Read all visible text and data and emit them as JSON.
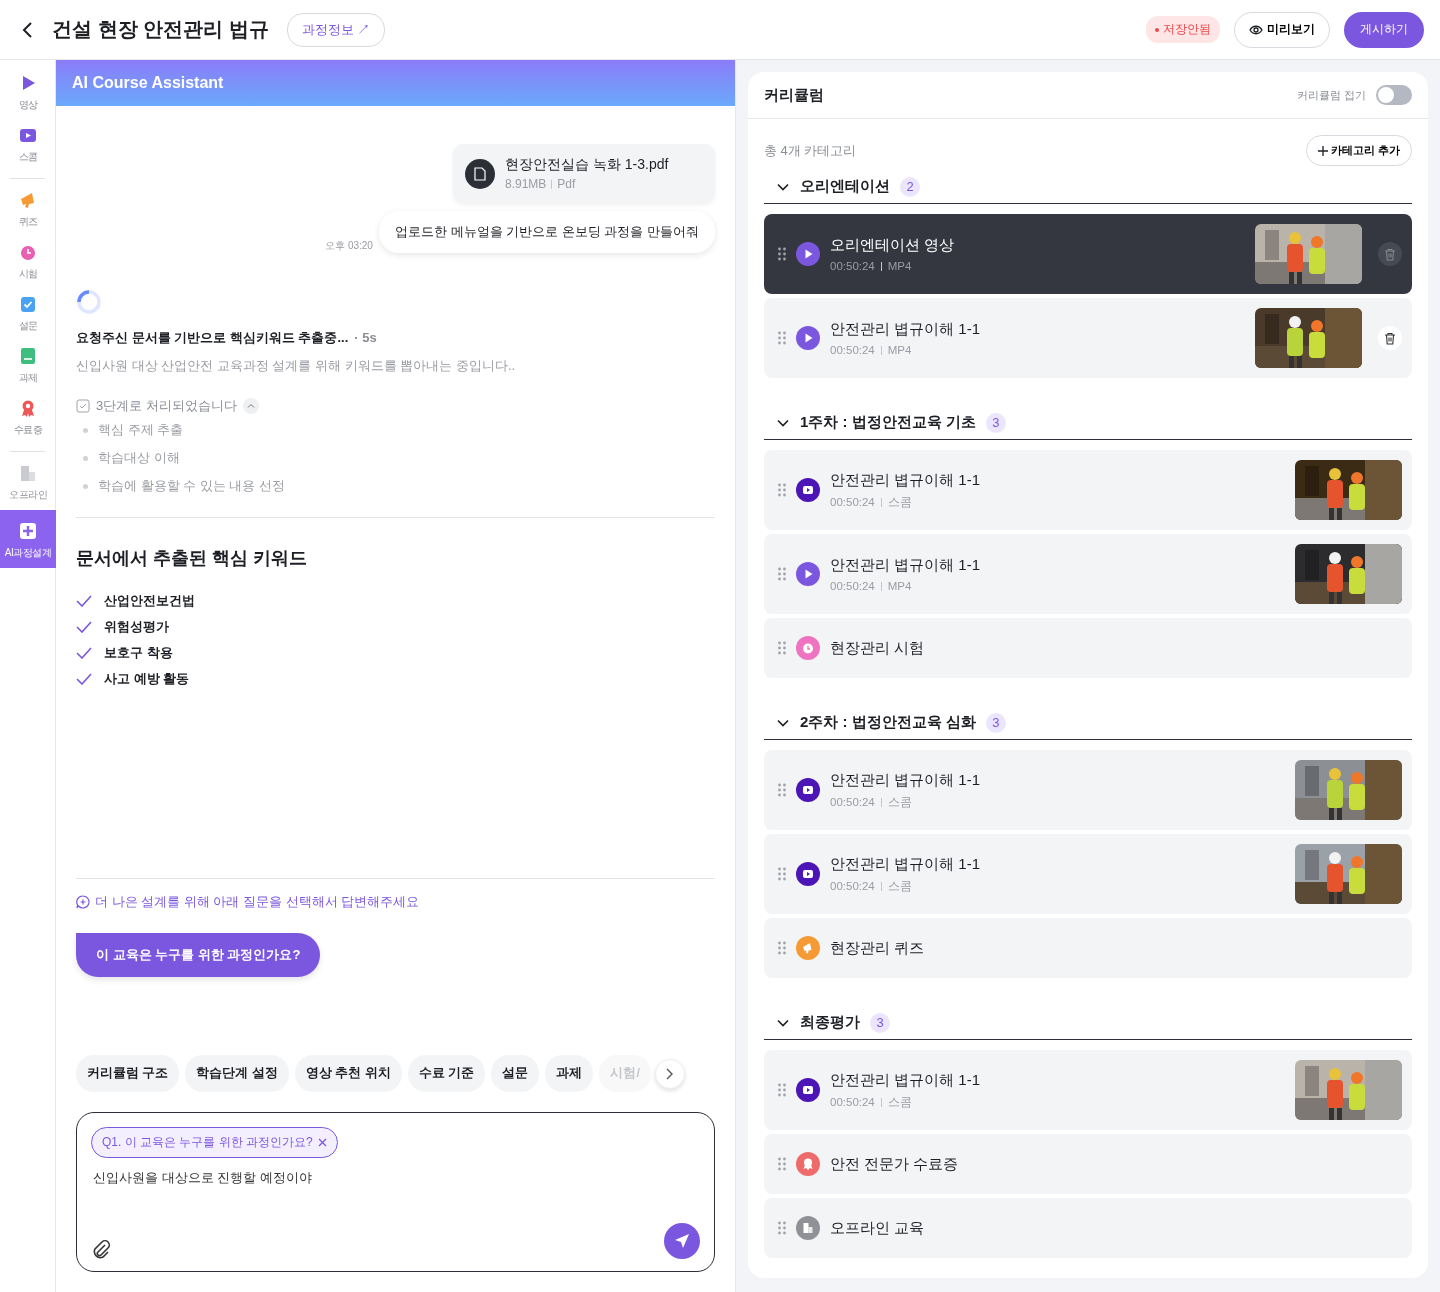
{
  "header": {
    "title": "건설 현장 안전관리 법규",
    "info_link": "과정정보 ↗",
    "status": "저장안됨",
    "preview": "미리보기",
    "publish": "게시하기"
  },
  "sidebar": {
    "groups": [
      [
        {
          "kind": "video",
          "label": "영상",
          "selected": false
        },
        {
          "kind": "scorm",
          "label": "스콤",
          "selected": false
        }
      ],
      [
        {
          "kind": "quiz",
          "label": "퀴즈",
          "selected": false
        },
        {
          "kind": "exam",
          "label": "시험",
          "selected": false
        },
        {
          "kind": "survey",
          "label": "설문",
          "selected": false
        },
        {
          "kind": "task",
          "label": "과제",
          "selected": false
        },
        {
          "kind": "certificate",
          "label": "수료증",
          "selected": false
        }
      ],
      [
        {
          "kind": "offline",
          "label": "오프라인",
          "selected": false
        },
        {
          "kind": "ai",
          "label": "AI과정설계",
          "selected": true
        }
      ]
    ]
  },
  "chat": {
    "title": "AI Course Assistant",
    "file": {
      "name": "현장안전실습 녹화 1-3.pdf",
      "size": "8.91MB",
      "type": "Pdf"
    },
    "user_message": "업로드한 메뉴얼을 기반으로 온보딩 과정을 만들어줘",
    "time": "오후 03:20",
    "progress": {
      "title": "요청주신 문서를 기반으로 핵심키워드 추출중...",
      "elapsed": "· 5s",
      "description": "신입사원 대상 산업안전 교육과정 설계를 위해 키워드를 뽑아내는 중입니다..",
      "steps_summary": "3단계로 처리되었습니다",
      "expanded": true,
      "steps": [
        "핵심 주제 추출",
        "학습대상 이해",
        "학습에 활용할 수 있는 내용 선정"
      ]
    },
    "keywords_title": "문서에서 추출된 핵심 키워드",
    "keywords": [
      "산업안전보건법",
      "위험성평가",
      "보호구 착용",
      "사고 예방 활동"
    ],
    "prompt_hint": "더 나은 설계를 위해 아래 질문을 선택해서 답변해주세요",
    "question_button": "이 교육은 누구를 위한 과정인가요?",
    "chips": [
      {
        "label": "커리큘럼 구조",
        "faded": false
      },
      {
        "label": "학습단계 설정",
        "faded": false
      },
      {
        "label": "영상 추천 위치",
        "faded": false
      },
      {
        "label": "수료 기준",
        "faded": false
      },
      {
        "label": "설문",
        "faded": false
      },
      {
        "label": "과제",
        "faded": false
      },
      {
        "label": "시험/",
        "faded": true
      }
    ],
    "input": {
      "tag": "Q1. 이 교육은 누구를 위한 과정인가요?",
      "value": "신입사원을 대상으로 진행할 예정이야"
    }
  },
  "curriculum": {
    "title": "커리큘럼",
    "collapse_label": "커리큘럼 접기",
    "collapse_on": false,
    "total": "총 4개 카테고리",
    "add_button": "카테고리 추가",
    "sections": [
      {
        "title": "오리엔테이션",
        "count": "2",
        "items": [
          {
            "kind": "video",
            "title": "오리엔테이션 영상",
            "duration": "00:50:24",
            "format": "MP4",
            "thumbnail": true,
            "selected": true,
            "show_delete": true
          },
          {
            "kind": "video",
            "title": "안전관리 볍규이해 1-1",
            "duration": "00:50:24",
            "format": "MP4",
            "thumbnail": true,
            "selected": false,
            "show_delete": true
          }
        ]
      },
      {
        "title": "1주차 : 법정안전교육 기초",
        "count": "3",
        "items": [
          {
            "kind": "scorm",
            "title": "안전관리 볍규이해 1-1",
            "duration": "00:50:24",
            "format": "스콤",
            "thumbnail": true,
            "selected": false,
            "show_delete": false
          },
          {
            "kind": "video",
            "title": "안전관리 볍규이해 1-1",
            "duration": "00:50:24",
            "format": "MP4",
            "thumbnail": true,
            "selected": false,
            "show_delete": false
          },
          {
            "kind": "exam",
            "title": "현장관리 시험",
            "thumbnail": false,
            "selected": false,
            "show_delete": false
          }
        ]
      },
      {
        "title": "2주차 : 법정안전교육 심화",
        "count": "3",
        "items": [
          {
            "kind": "scorm",
            "title": "안전관리 볍규이해 1-1",
            "duration": "00:50:24",
            "format": "스콤",
            "thumbnail": true,
            "selected": false,
            "show_delete": false
          },
          {
            "kind": "scorm",
            "title": "안전관리 볍규이해 1-1",
            "duration": "00:50:24",
            "format": "스콤",
            "thumbnail": true,
            "selected": false,
            "show_delete": false
          },
          {
            "kind": "quiz",
            "title": "현장관리 퀴즈",
            "thumbnail": false,
            "selected": false,
            "show_delete": false
          }
        ]
      },
      {
        "title": "최종평가",
        "count": "3",
        "items": [
          {
            "kind": "scorm",
            "title": "안전관리 볍규이해 1-1",
            "duration": "00:50:24",
            "format": "스콤",
            "thumbnail": true,
            "selected": false,
            "show_delete": false
          },
          {
            "kind": "certificate",
            "title": "안전 전문가 수료증",
            "thumbnail": false,
            "selected": false,
            "show_delete": false
          },
          {
            "kind": "offline",
            "title": "오프라인 교육",
            "thumbnail": false,
            "selected": false,
            "show_delete": false
          }
        ]
      }
    ]
  }
}
